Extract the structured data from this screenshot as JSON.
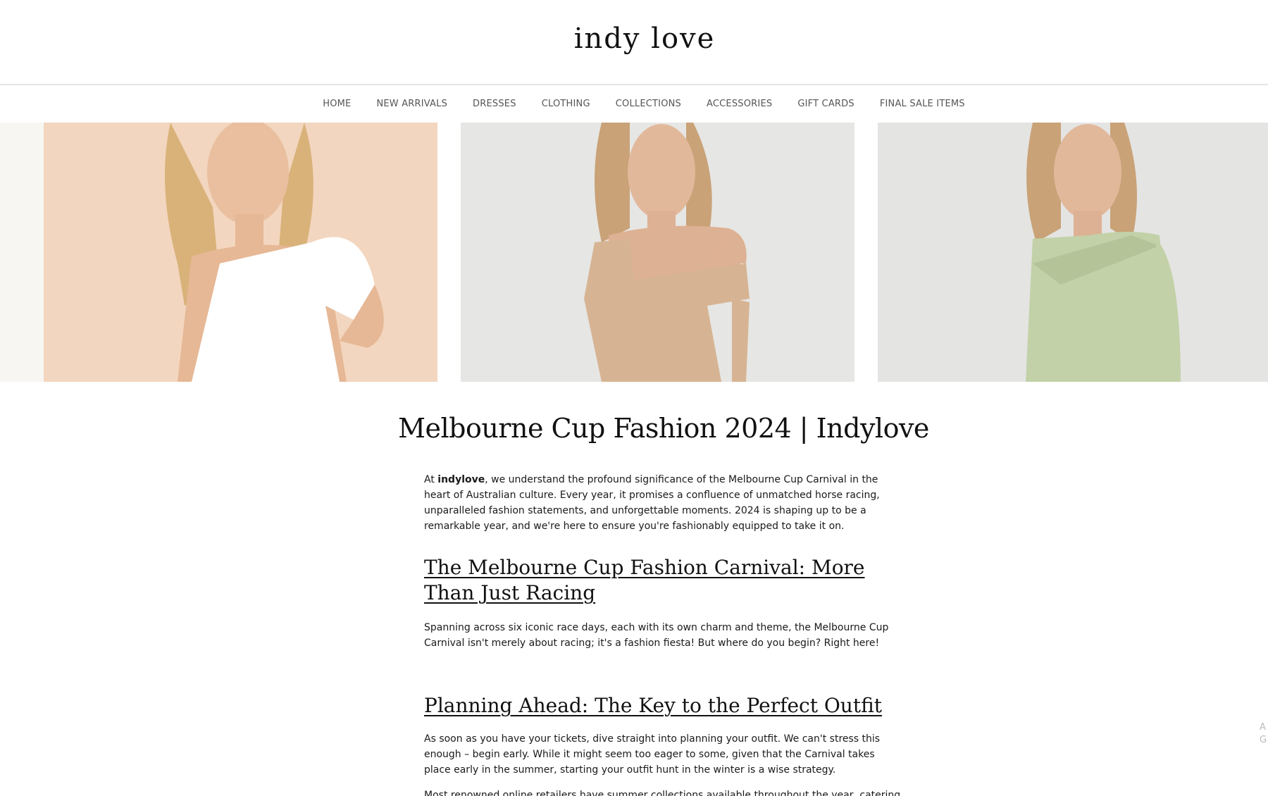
{
  "brand": {
    "logo": "indy love"
  },
  "nav": {
    "items": [
      "HOME",
      "NEW ARRIVALS",
      "DRESSES",
      "CLOTHING",
      "COLLECTIONS",
      "ACCESSORIES",
      "GIFT CARDS",
      "FINAL SALE ITEMS"
    ]
  },
  "gallery": {
    "photos": [
      {
        "subject": "model-white-one-shoulder-dress",
        "background": "#f3d6bf",
        "garment": "#ffffff"
      },
      {
        "subject": "model-beige-off-shoulder-knit-dress",
        "background": "#e6e6e4",
        "garment": "#d6b493"
      },
      {
        "subject": "model-sage-green-knit-dress",
        "background": "#e4e4e2",
        "garment": "#c2d1a8"
      }
    ]
  },
  "article": {
    "title": "Melbourne Cup Fashion 2024 | Indylove",
    "intro": {
      "prefix": "At ",
      "bold": "indylove",
      "rest": ", we understand the profound significance of the Melbourne Cup Carnival in the heart of Australian culture. Every year, it promises a confluence of unmatched horse racing, unparalleled fashion statements, and unforgettable moments. 2024 is shaping up to be a remarkable year, and we're here to ensure you're fashionably equipped to take it on."
    },
    "section1": {
      "heading": "The Melbourne Cup Fashion Carnival: More Than Just Racing",
      "body": "Spanning across six iconic race days, each with its own charm and theme, the Melbourne Cup Carnival isn't merely about racing; it's a fashion fiesta! But where do you begin? Right here!"
    },
    "section2": {
      "heading": "Planning Ahead: The Key to the Perfect Outfit",
      "body": "As soon as you have your tickets, dive straight into planning your outfit. We can't stress this enough – begin early. While it might seem too eager to some, given that the Carnival takes place early in the summer, starting your outfit hunt in the winter is a wise strategy.",
      "body2": "Most renowned online retailers have summer collections available throughout the year, catering to"
    }
  },
  "side_tab": {
    "text": "A G"
  }
}
